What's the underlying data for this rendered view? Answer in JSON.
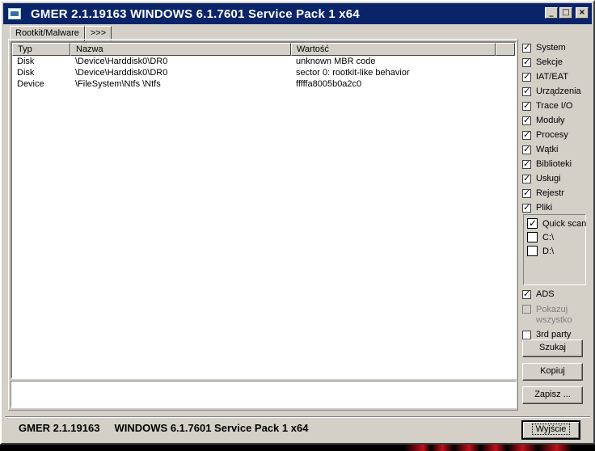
{
  "window": {
    "title": "GMER 2.1.19163     WINDOWS 6.1.7601 Service Pack 1 x64",
    "min_label": "_",
    "max_label": "□",
    "close_label": "×"
  },
  "tabs": [
    {
      "label": "Rootkit/Malware",
      "active": true
    },
    {
      "label": ">>>",
      "active": false
    }
  ],
  "table": {
    "columns": [
      "Typ",
      "Nazwa",
      "Wartość"
    ],
    "rows": [
      [
        "Disk",
        "\\Device\\Harddisk0\\DR0",
        "unknown MBR code"
      ],
      [
        "Disk",
        "\\Device\\Harddisk0\\DR0",
        "sector 0: rootkit-like behavior"
      ],
      [
        "Device",
        "\\FileSystem\\Ntfs \\Ntfs",
        "fffffa8005b0a2c0"
      ]
    ]
  },
  "scan_options": [
    {
      "label": "System",
      "checked": true
    },
    {
      "label": "Sekcje",
      "checked": true
    },
    {
      "label": "IAT/EAT",
      "checked": true
    },
    {
      "label": "Urządzenia",
      "checked": true
    },
    {
      "label": "Trace I/O",
      "checked": true
    },
    {
      "label": "Moduły",
      "checked": true
    },
    {
      "label": "Procesy",
      "checked": true
    },
    {
      "label": "Wątki",
      "checked": true
    },
    {
      "label": "Biblioteki",
      "checked": true
    },
    {
      "label": "Usługi",
      "checked": true
    },
    {
      "label": "Rejestr",
      "checked": true
    },
    {
      "label": "Pliki",
      "checked": true
    }
  ],
  "drives": [
    {
      "label": "Quick scan",
      "checked": true
    },
    {
      "label": "C:\\",
      "checked": false
    },
    {
      "label": "D:\\",
      "checked": false
    }
  ],
  "extra_options": {
    "ads": {
      "label": "ADS",
      "checked": true
    },
    "show_all": {
      "label": "Pokazuj wszystko",
      "checked": false,
      "disabled": true
    },
    "third_party": {
      "label": "3rd party",
      "checked": false
    }
  },
  "buttons": {
    "scan": "Szukaj",
    "copy": "Kopiuj",
    "save": "Zapisz ..."
  },
  "status": {
    "text": "GMER 2.1.19163     WINDOWS 6.1.7601 Service Pack 1 x64",
    "exit_label": "Wyjście"
  }
}
